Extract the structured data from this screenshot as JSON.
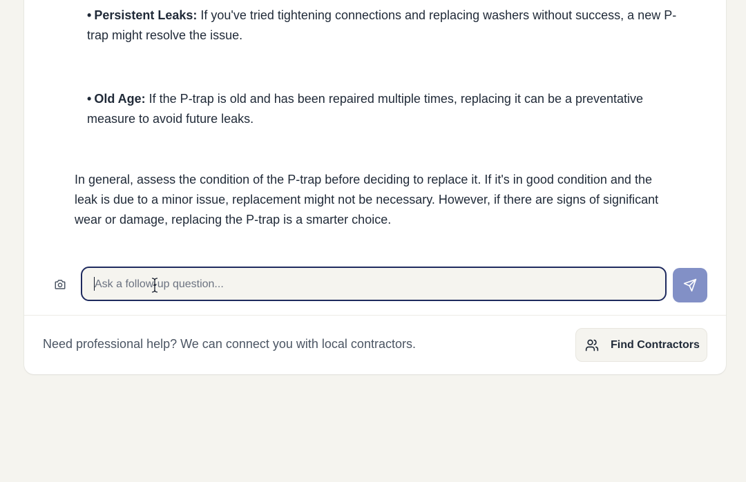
{
  "bullets": [
    {
      "title": "Persistent Leaks:",
      "text": " If you've tried tightening connections and replacing washers without success, a new P-trap might resolve the issue."
    },
    {
      "title": "Old Age:",
      "text": " If the P-trap is old and has been repaired multiple times, replacing it can be a preventative measure to avoid future leaks."
    }
  ],
  "bullet_marker": "•",
  "summary": "In general, assess the condition of the P-trap before deciding to replace it. If it's in good condition and the leak is due to a minor issue, replacement might not be necessary. However, if there are signs of significant wear or damage, replacing the P-trap is a smarter choice.",
  "composer": {
    "placeholder": "Ask a follow-up question...",
    "value": "",
    "camera_icon": "camera-icon",
    "send_icon": "send-icon"
  },
  "footer": {
    "help_text": "Need professional help? We can connect you with local contractors.",
    "button_label": "Find Contractors",
    "button_icon": "users-icon"
  },
  "colors": {
    "page_bg": "#f5f4ef",
    "card_bg": "#ffffff",
    "input_border": "#1e2a5e",
    "send_button": "#8290c6",
    "text": "#1f2937",
    "muted_text": "#4b5563"
  }
}
